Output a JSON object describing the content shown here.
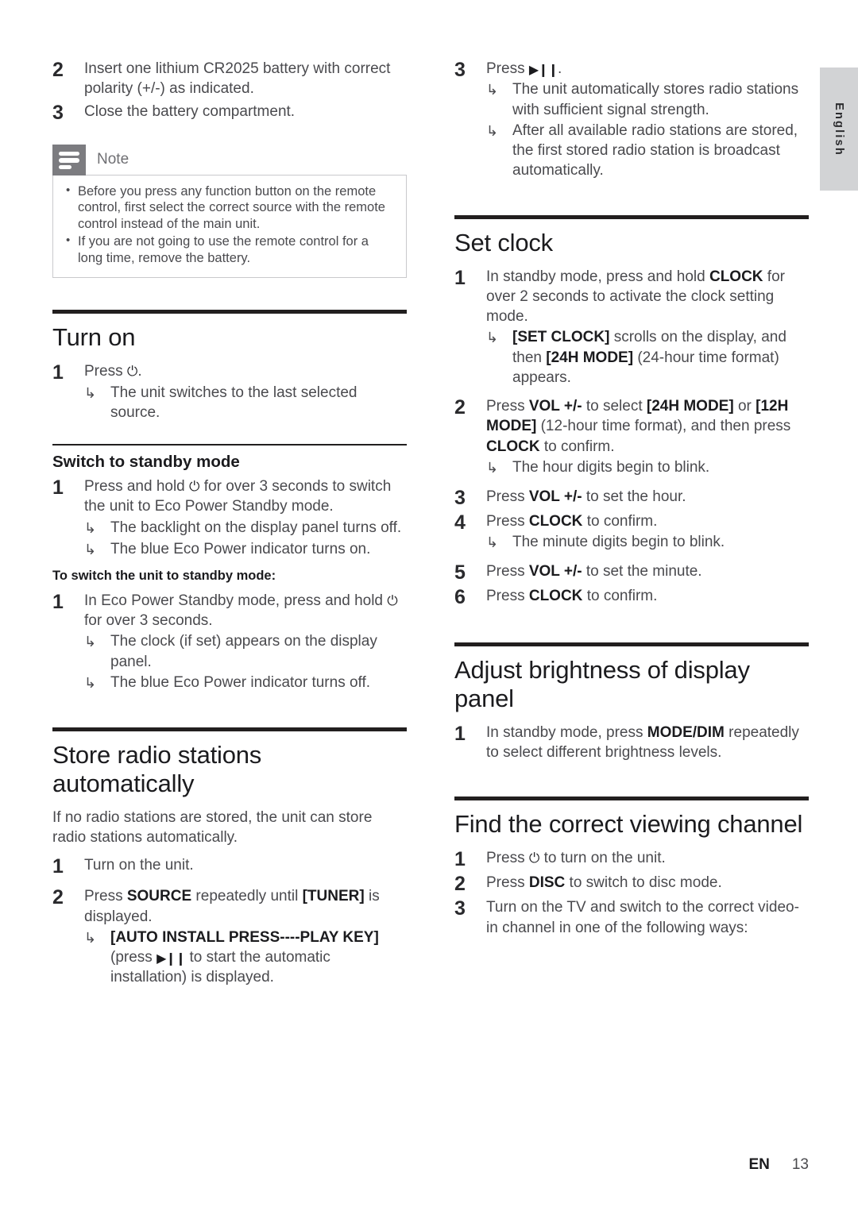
{
  "language_tab": {
    "label": "English"
  },
  "footer": {
    "lang_code": "EN",
    "page_number": "13"
  },
  "icons": {
    "power": "⏻",
    "play_pause": "▶❙❙",
    "result_arrow": "↳",
    "note_icon": "note-lines-icon"
  },
  "left_column": {
    "battery_steps": [
      {
        "num": "2",
        "text": "Insert one lithium CR2025 battery with correct polarity (+/-) as indicated."
      },
      {
        "num": "3",
        "text": "Close the battery compartment."
      }
    ],
    "note": {
      "title": "Note",
      "items": [
        "Before you press any function button on the remote control, first select the correct source with the remote control instead of the main unit.",
        "If you are not going to use the remote control for a long time, remove the battery."
      ]
    },
    "turn_on": {
      "heading": "Turn on",
      "step_num": "1",
      "step_pre": "Press ",
      "step_post": ".",
      "result": "The unit switches to the last selected source."
    },
    "standby": {
      "heading": "Switch to standby mode",
      "step_num": "1",
      "step_pre": "Press and hold ",
      "step_post": " for over 3 seconds to switch the unit to Eco Power Standby mode.",
      "results": [
        "The backlight on the display panel turns off.",
        "The blue Eco Power indicator turns on."
      ],
      "mini_heading": "To switch the unit to standby mode:",
      "step2_num": "1",
      "step2_pre": "In Eco Power Standby mode, press and hold ",
      "step2_post": " for over 3 seconds.",
      "results2": [
        "The clock (if set) appears on the display panel.",
        "The blue Eco Power indicator turns off."
      ]
    },
    "store_radio": {
      "heading": "Store radio stations automatically",
      "intro": "If no radio stations are stored, the unit can store radio stations automatically.",
      "step1_num": "1",
      "step1_text": "Turn on the unit.",
      "step2_num": "2",
      "step2_part1": "Press ",
      "step2_bold1": "SOURCE",
      "step2_part2": " repeatedly until ",
      "step2_bold2": "[TUNER]",
      "step2_part3": " is displayed.",
      "result_bold": "[AUTO INSTALL PRESS----PLAY KEY]",
      "result_mid": " (press ",
      "result_end": " to start the automatic installation) is displayed."
    }
  },
  "right_column": {
    "press_play": {
      "step_num": "3",
      "step_pre": "Press ",
      "step_post": ".",
      "results": [
        "The unit automatically stores radio stations with sufficient signal strength.",
        "After all available radio stations are stored, the first stored radio station is broadcast automatically."
      ]
    },
    "set_clock": {
      "heading": "Set clock",
      "step1_num": "1",
      "step1_part1": "In standby mode, press and hold ",
      "step1_bold1": "CLOCK",
      "step1_part2": " for over 2 seconds to activate the clock setting mode.",
      "step1_result_bold1": "[SET CLOCK]",
      "step1_result_mid": " scrolls on the display, and then ",
      "step1_result_bold2": "[24H MODE]",
      "step1_result_end": " (24-hour time format) appears.",
      "step2_num": "2",
      "step2_part1": "Press ",
      "step2_bold1": "VOL +/-",
      "step2_part2": " to select ",
      "step2_bold2": "[24H MODE]",
      "step2_part3": " or ",
      "step2_bold3": "[12H MODE]",
      "step2_part4": " (12-hour time format), and then press ",
      "step2_bold4": "CLOCK",
      "step2_part5": " to confirm.",
      "step2_result": "The hour digits begin to blink.",
      "step3_num": "3",
      "step3_part1": "Press ",
      "step3_bold1": "VOL +/-",
      "step3_part2": " to set the hour.",
      "step4_num": "4",
      "step4_part1": "Press ",
      "step4_bold1": "CLOCK",
      "step4_part2": " to confirm.",
      "step4_result": "The minute digits begin to blink.",
      "step5_num": "5",
      "step5_part1": "Press ",
      "step5_bold1": "VOL +/-",
      "step5_part2": " to set the minute.",
      "step6_num": "6",
      "step6_part1": "Press ",
      "step6_bold1": "CLOCK",
      "step6_part2": " to confirm."
    },
    "brightness": {
      "heading": "Adjust brightness of display panel",
      "step_num": "1",
      "step_part1": "In standby mode, press ",
      "step_bold1": "MODE/DIM",
      "step_part2": " repeatedly to select different brightness levels."
    },
    "viewing_channel": {
      "heading": "Find the correct viewing channel",
      "step1_num": "1",
      "step1_pre": "Press ",
      "step1_post": " to turn on the unit.",
      "step2_num": "2",
      "step2_part1": "Press ",
      "step2_bold1": "DISC",
      "step2_part2": " to switch to disc mode.",
      "step3_num": "3",
      "step3_text": "Turn on the TV and switch to the correct video-in channel in one of the following ways:"
    }
  }
}
